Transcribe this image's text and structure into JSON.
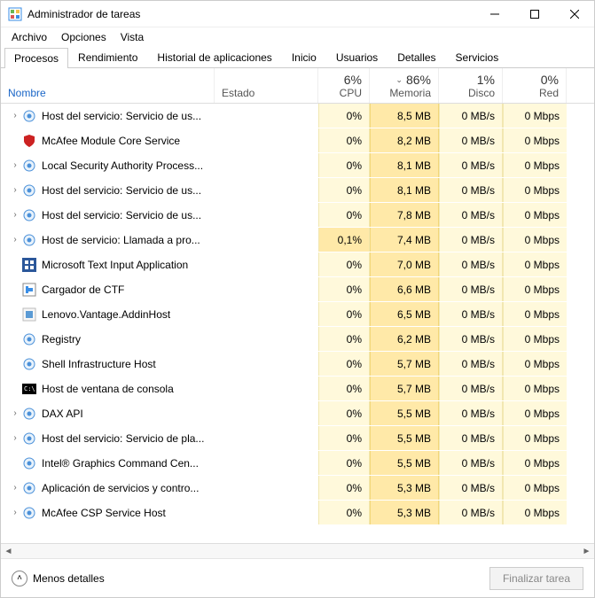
{
  "window": {
    "title": "Administrador de tareas"
  },
  "menu": {
    "file": "Archivo",
    "options": "Opciones",
    "view": "Vista"
  },
  "tabs": [
    {
      "label": "Procesos"
    },
    {
      "label": "Rendimiento"
    },
    {
      "label": "Historial de aplicaciones"
    },
    {
      "label": "Inicio"
    },
    {
      "label": "Usuarios"
    },
    {
      "label": "Detalles"
    },
    {
      "label": "Servicios"
    }
  ],
  "columns": {
    "name": "Nombre",
    "status": "Estado",
    "cpu_pct": "6%",
    "cpu_label": "CPU",
    "mem_pct": "86%",
    "mem_label": "Memoria",
    "disk_pct": "1%",
    "disk_label": "Disco",
    "net_pct": "0%",
    "net_label": "Red"
  },
  "processes": [
    {
      "expandable": true,
      "icon": "gear",
      "name": "Host del servicio: Servicio de us...",
      "cpu": "0%",
      "mem": "8,5 MB",
      "disk": "0 MB/s",
      "net": "0 Mbps"
    },
    {
      "expandable": false,
      "icon": "mcafee",
      "name": "McAfee Module Core Service",
      "cpu": "0%",
      "mem": "8,2 MB",
      "disk": "0 MB/s",
      "net": "0 Mbps"
    },
    {
      "expandable": true,
      "icon": "gear",
      "name": "Local Security Authority Process...",
      "cpu": "0%",
      "mem": "8,1 MB",
      "disk": "0 MB/s",
      "net": "0 Mbps"
    },
    {
      "expandable": true,
      "icon": "gear",
      "name": "Host del servicio: Servicio de us...",
      "cpu": "0%",
      "mem": "8,1 MB",
      "disk": "0 MB/s",
      "net": "0 Mbps"
    },
    {
      "expandable": true,
      "icon": "gear",
      "name": "Host del servicio: Servicio de us...",
      "cpu": "0%",
      "mem": "7,8 MB",
      "disk": "0 MB/s",
      "net": "0 Mbps"
    },
    {
      "expandable": true,
      "icon": "gear",
      "name": "Host de servicio: Llamada a pro...",
      "cpu": "0,1%",
      "mem": "7,4 MB",
      "disk": "0 MB/s",
      "net": "0 Mbps",
      "cpu_hot": true
    },
    {
      "expandable": false,
      "icon": "msblue",
      "name": "Microsoft Text Input Application",
      "cpu": "0%",
      "mem": "7,0 MB",
      "disk": "0 MB/s",
      "net": "0 Mbps"
    },
    {
      "expandable": false,
      "icon": "ctf",
      "name": "Cargador de CTF",
      "cpu": "0%",
      "mem": "6,6 MB",
      "disk": "0 MB/s",
      "net": "0 Mbps"
    },
    {
      "expandable": false,
      "icon": "generic",
      "name": "Lenovo.Vantage.AddinHost",
      "cpu": "0%",
      "mem": "6,5 MB",
      "disk": "0 MB/s",
      "net": "0 Mbps"
    },
    {
      "expandable": false,
      "icon": "gear",
      "name": "Registry",
      "cpu": "0%",
      "mem": "6,2 MB",
      "disk": "0 MB/s",
      "net": "0 Mbps"
    },
    {
      "expandable": false,
      "icon": "gear",
      "name": "Shell Infrastructure Host",
      "cpu": "0%",
      "mem": "5,7 MB",
      "disk": "0 MB/s",
      "net": "0 Mbps"
    },
    {
      "expandable": false,
      "icon": "console",
      "name": "Host de ventana de consola",
      "cpu": "0%",
      "mem": "5,7 MB",
      "disk": "0 MB/s",
      "net": "0 Mbps"
    },
    {
      "expandable": true,
      "icon": "gear",
      "name": "DAX API",
      "cpu": "0%",
      "mem": "5,5 MB",
      "disk": "0 MB/s",
      "net": "0 Mbps"
    },
    {
      "expandable": true,
      "icon": "gear",
      "name": "Host del servicio: Servicio de pla...",
      "cpu": "0%",
      "mem": "5,5 MB",
      "disk": "0 MB/s",
      "net": "0 Mbps"
    },
    {
      "expandable": false,
      "icon": "gear",
      "name": "Intel® Graphics Command Cen...",
      "cpu": "0%",
      "mem": "5,5 MB",
      "disk": "0 MB/s",
      "net": "0 Mbps"
    },
    {
      "expandable": true,
      "icon": "gear",
      "name": "Aplicación de servicios y contro...",
      "cpu": "0%",
      "mem": "5,3 MB",
      "disk": "0 MB/s",
      "net": "0 Mbps"
    },
    {
      "expandable": true,
      "icon": "gear",
      "name": "McAfee CSP Service Host",
      "cpu": "0%",
      "mem": "5,3 MB",
      "disk": "0 MB/s",
      "net": "0 Mbps"
    }
  ],
  "footer": {
    "fewer": "Menos detalles",
    "endtask": "Finalizar tarea"
  }
}
